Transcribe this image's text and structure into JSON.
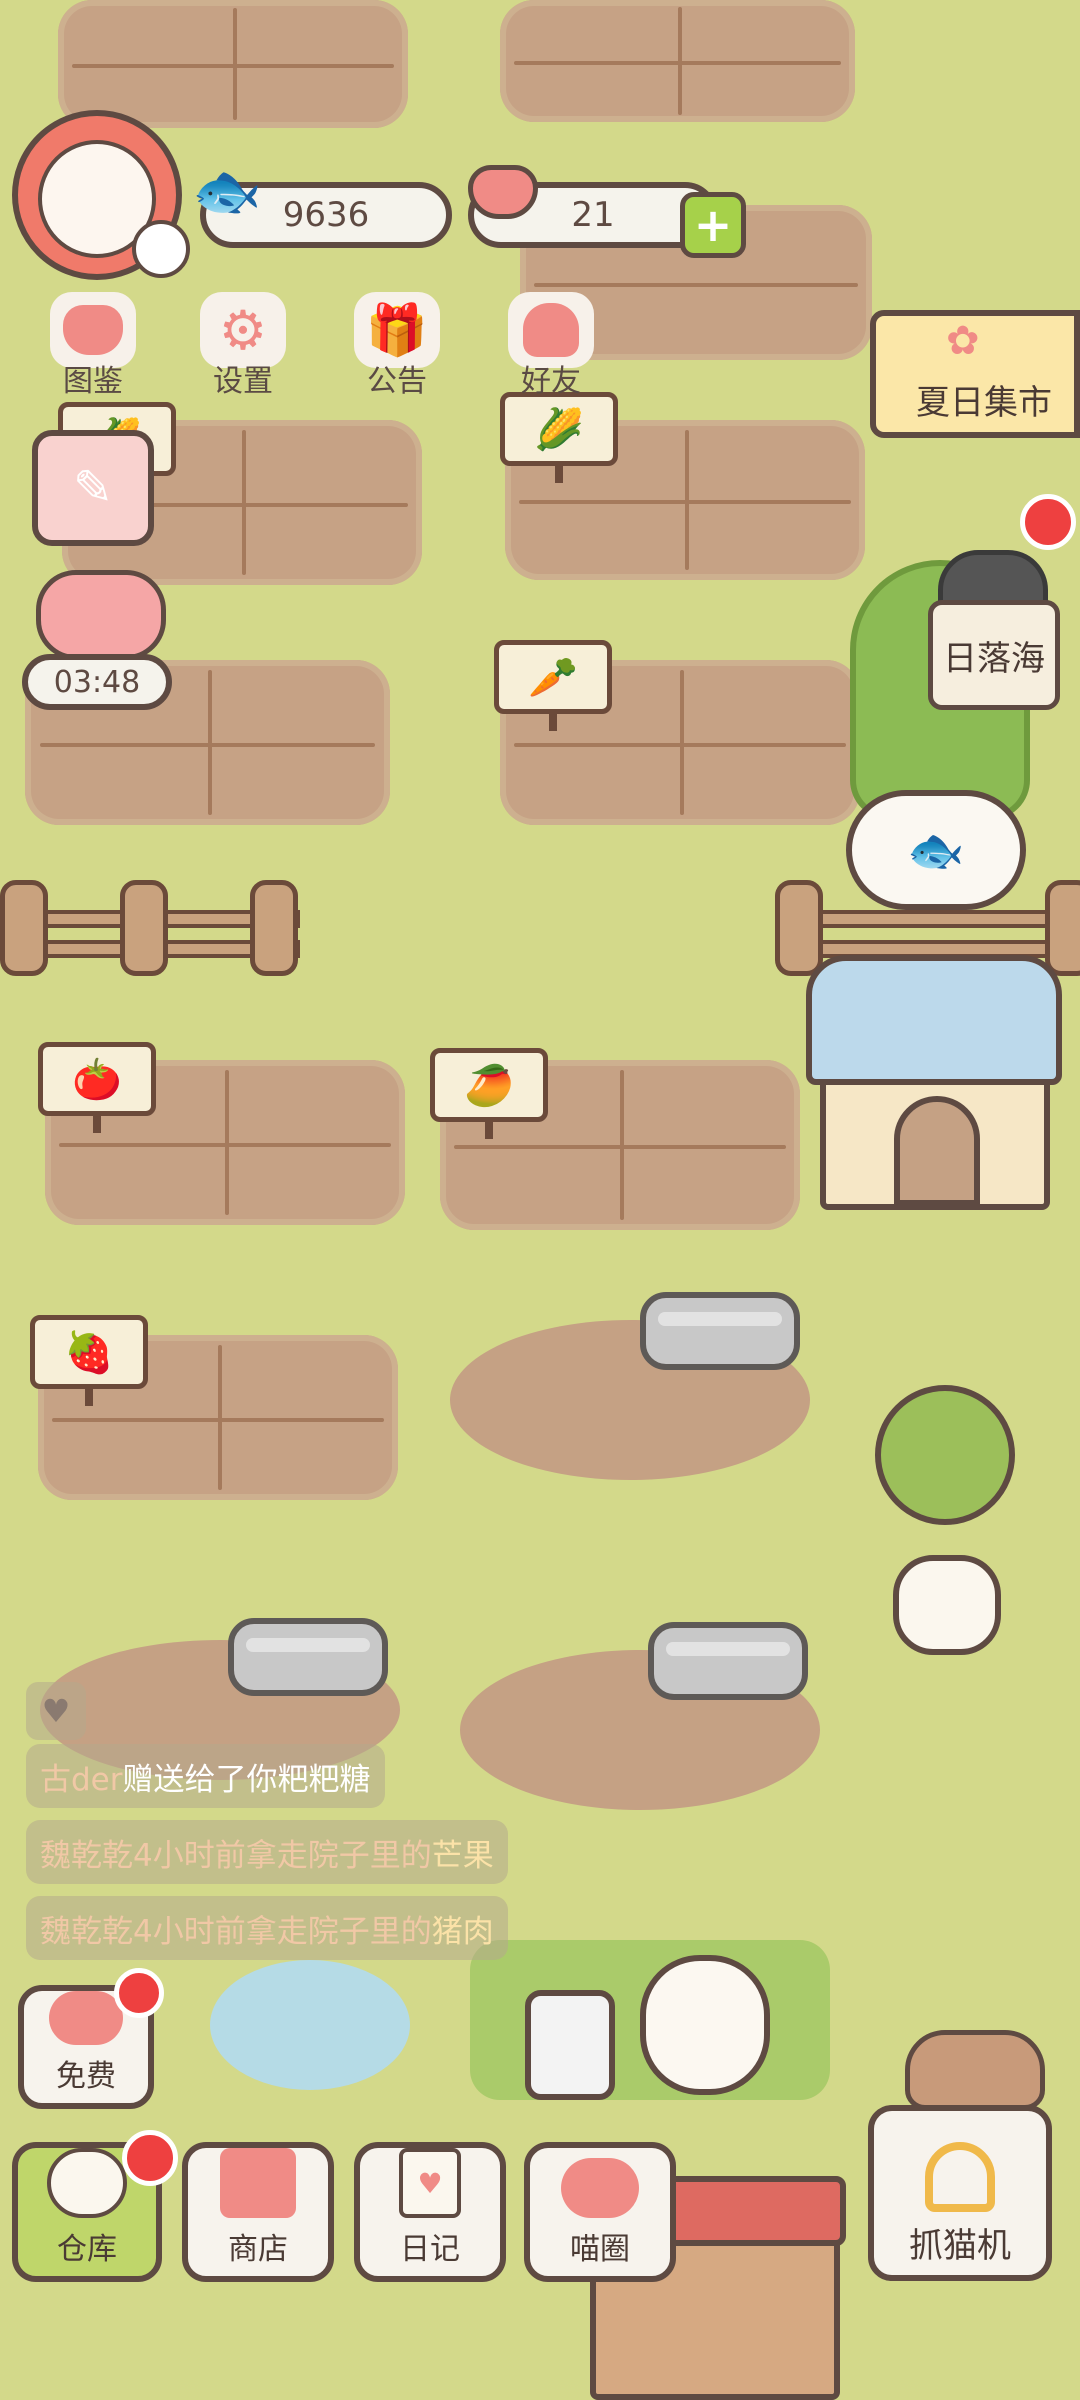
{
  "hud": {
    "fish_count": "9636",
    "heart_count": "21",
    "plus_label": "+"
  },
  "top_menu": [
    {
      "label": "图鉴",
      "icon": "cat-head-icon"
    },
    {
      "label": "设置",
      "icon": "gear-icon"
    },
    {
      "label": "公告",
      "icon": "gift-icon"
    },
    {
      "label": "好友",
      "icon": "friends-icon"
    }
  ],
  "timer": "03:48",
  "destinations": {
    "summer_market": "夏日集市",
    "sunset_sea": "日落海"
  },
  "feed": [
    {
      "name": "古der",
      "text": "赠送给了你粑粑糖"
    },
    {
      "prefix": "魏乾乾4小时前拿走院子里的",
      "item": "芒果"
    },
    {
      "prefix": "魏乾乾4小时前拿走院子里的",
      "item": "猪肉"
    }
  ],
  "bottom_nav": [
    {
      "label": "免费",
      "icon": "heart-icon"
    },
    {
      "label": "仓库",
      "icon": "rice-bowl-icon"
    },
    {
      "label": "商店",
      "icon": "shop-icon"
    },
    {
      "label": "日记",
      "icon": "diary-icon"
    },
    {
      "label": "喵圈",
      "icon": "cat-planet-icon"
    },
    {
      "label": "抓猫机",
      "icon": "claw-icon"
    }
  ],
  "crop_signs": [
    "corn",
    "corn",
    "carrot",
    "tomato",
    "mango",
    "strawberry"
  ],
  "colors": {
    "grass": "#d3d98a",
    "soil": "#c6a285",
    "accent_red": "#ee4040",
    "outline": "#5e4a42"
  }
}
